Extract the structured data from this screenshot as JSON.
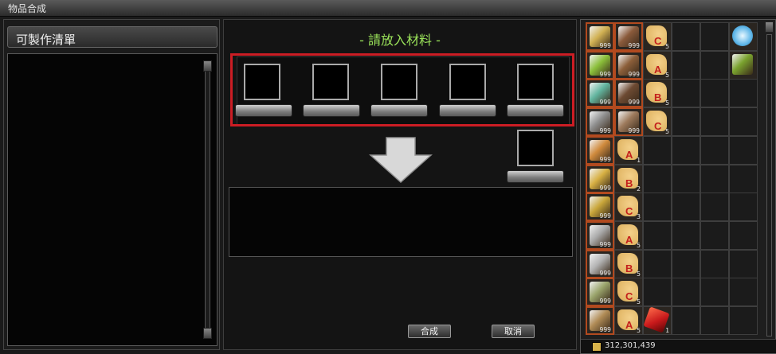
{
  "window": {
    "title": "物品合成"
  },
  "left": {
    "header": "可製作清單"
  },
  "center": {
    "materials_title": "- 請放入材料 -",
    "buttons": {
      "craft": "合成",
      "cancel": "取消"
    }
  },
  "inventory": {
    "gold": "312,301,439",
    "rows": [
      [
        {
          "icon": "yellow-gem",
          "qty": "999",
          "color": "#d1b153"
        },
        {
          "icon": "wood-plank",
          "qty": "999",
          "color": "#8a5a3b"
        },
        {
          "icon": "scroll",
          "letter": "C",
          "qty": "5",
          "color": "#e2b767"
        },
        {},
        {},
        {
          "icon": "blue-crystal",
          "color": "#5eb6e8"
        }
      ],
      [
        {
          "icon": "green-herb",
          "qty": "999",
          "color": "#8bbf3a"
        },
        {
          "icon": "brown-leather",
          "qty": "999",
          "color": "#8c5f3a"
        },
        {
          "icon": "scroll",
          "letter": "A",
          "qty": "5",
          "color": "#e2b767"
        },
        {},
        {},
        {
          "icon": "red-pot",
          "color": "#7aa22e"
        }
      ],
      [
        {
          "icon": "teal-gem",
          "qty": "999",
          "color": "#62b59f"
        },
        {
          "icon": "dark-wood",
          "qty": "999",
          "color": "#6d4a32"
        },
        {
          "icon": "scroll",
          "letter": "B",
          "qty": "5",
          "color": "#e2b767"
        },
        {},
        {},
        {}
      ],
      [
        {
          "icon": "gray-ore",
          "qty": "999",
          "color": "#8f8f8f"
        },
        {
          "icon": "cloth-roll",
          "qty": "999",
          "color": "#9d7a5c"
        },
        {
          "icon": "scroll",
          "letter": "C",
          "qty": "5",
          "color": "#e2b767"
        },
        {},
        {},
        {}
      ],
      [
        {
          "icon": "orange-ore",
          "qty": "999",
          "color": "#d08b3d"
        },
        {
          "icon": "scroll",
          "letter": "A",
          "qty": "1",
          "color": "#e2b767"
        },
        {},
        {},
        {},
        {}
      ],
      [
        {
          "icon": "gold-gem",
          "qty": "999",
          "color": "#d7b043"
        },
        {
          "icon": "scroll",
          "letter": "B",
          "qty": "2",
          "color": "#e2b767"
        },
        {},
        {},
        {},
        {}
      ],
      [
        {
          "icon": "gold-ore",
          "qty": "999",
          "color": "#c9a63a"
        },
        {
          "icon": "scroll",
          "letter": "C",
          "qty": "3",
          "color": "#e2b767"
        },
        {},
        {},
        {},
        {}
      ],
      [
        {
          "icon": "silver-ore",
          "qty": "999",
          "color": "#a9a9a9"
        },
        {
          "icon": "scroll",
          "letter": "A",
          "qty": "5",
          "color": "#e2b767"
        },
        {},
        {},
        {},
        {}
      ],
      [
        {
          "icon": "silver-ingot",
          "qty": "999",
          "color": "#b3b3b3"
        },
        {
          "icon": "scroll",
          "letter": "B",
          "qty": "5",
          "color": "#e2b767"
        },
        {},
        {},
        {},
        {}
      ],
      [
        {
          "icon": "green-ore",
          "qty": "999",
          "color": "#9aa46b"
        },
        {
          "icon": "scroll",
          "letter": "C",
          "qty": "5",
          "color": "#e2b767"
        },
        {},
        {},
        {},
        {}
      ],
      [
        {
          "icon": "mixed-ore",
          "qty": "999",
          "color": "#b08b55"
        },
        {
          "icon": "scroll",
          "letter": "A",
          "qty": "5",
          "color": "#e2b767"
        },
        {
          "icon": "red-crystal",
          "qty": "1",
          "color": "#c8191b"
        },
        {},
        {},
        {}
      ]
    ]
  }
}
